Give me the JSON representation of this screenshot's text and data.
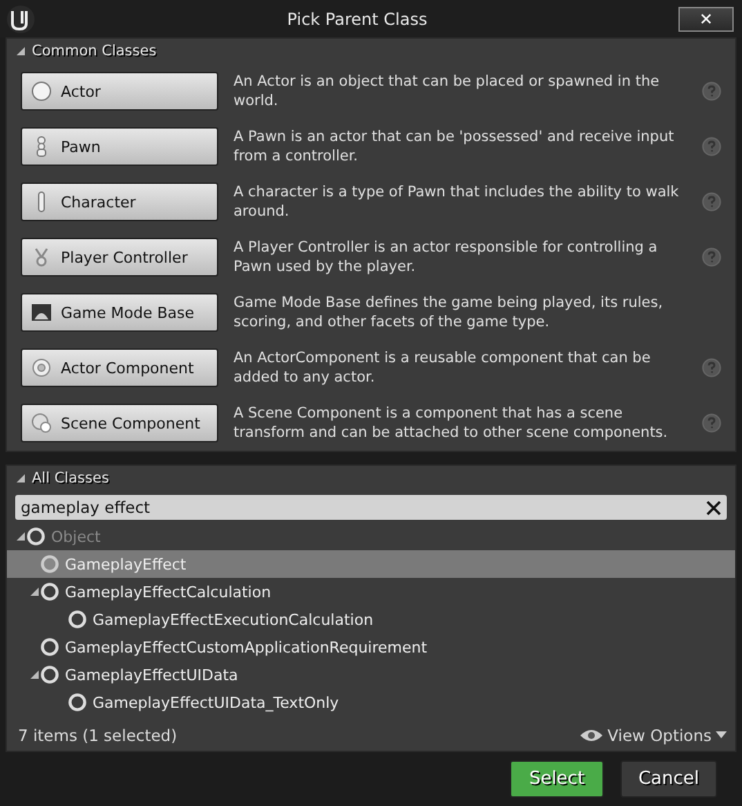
{
  "window": {
    "title": "Pick Parent Class",
    "close": "✕"
  },
  "common_classes": {
    "title": "Common Classes",
    "expanded": true,
    "items": [
      {
        "label": "Actor",
        "description": "An Actor is an object that can be placed or spawned in the world."
      },
      {
        "label": "Pawn",
        "description": "A Pawn is an actor that can be 'possessed' and receive input from a controller."
      },
      {
        "label": "Character",
        "description": "A character is a type of Pawn that includes the ability to walk around."
      },
      {
        "label": "Player Controller",
        "description": "A Player Controller is an actor responsible for controlling a Pawn used by the player."
      },
      {
        "label": "Game Mode Base",
        "description": "Game Mode Base defines the game being played, its rules, scoring, and other facets of the game type."
      },
      {
        "label": "Actor Component",
        "description": "An ActorComponent is a reusable component that can be added to any actor."
      },
      {
        "label": "Scene Component",
        "description": "A Scene Component is a component that has a scene transform and can be attached to other scene components."
      }
    ]
  },
  "all_classes": {
    "title": "All Classes",
    "expanded": true,
    "search": {
      "value": "gameplay effect"
    },
    "tree": [
      {
        "label": "Object",
        "disabled": true,
        "selected": false,
        "expanded": true,
        "children": [
          {
            "label": "GameplayEffect",
            "disabled": false,
            "selected": true
          },
          {
            "label": "GameplayEffectCalculation",
            "disabled": false,
            "selected": false,
            "expanded": true,
            "children": [
              {
                "label": "GameplayEffectExecutionCalculation",
                "disabled": false,
                "selected": false
              }
            ]
          },
          {
            "label": "GameplayEffectCustomApplicationRequirement",
            "disabled": false,
            "selected": false
          },
          {
            "label": "GameplayEffectUIData",
            "disabled": false,
            "selected": false,
            "expanded": true,
            "children": [
              {
                "label": "GameplayEffectUIData_TextOnly",
                "disabled": false,
                "selected": false
              }
            ]
          }
        ]
      }
    ],
    "status": "7 items (1 selected)",
    "view_options": "View Options"
  },
  "buttons": [
    {
      "label": "Select",
      "kind": "primary"
    },
    {
      "label": "Cancel",
      "kind": "secondary"
    }
  ]
}
